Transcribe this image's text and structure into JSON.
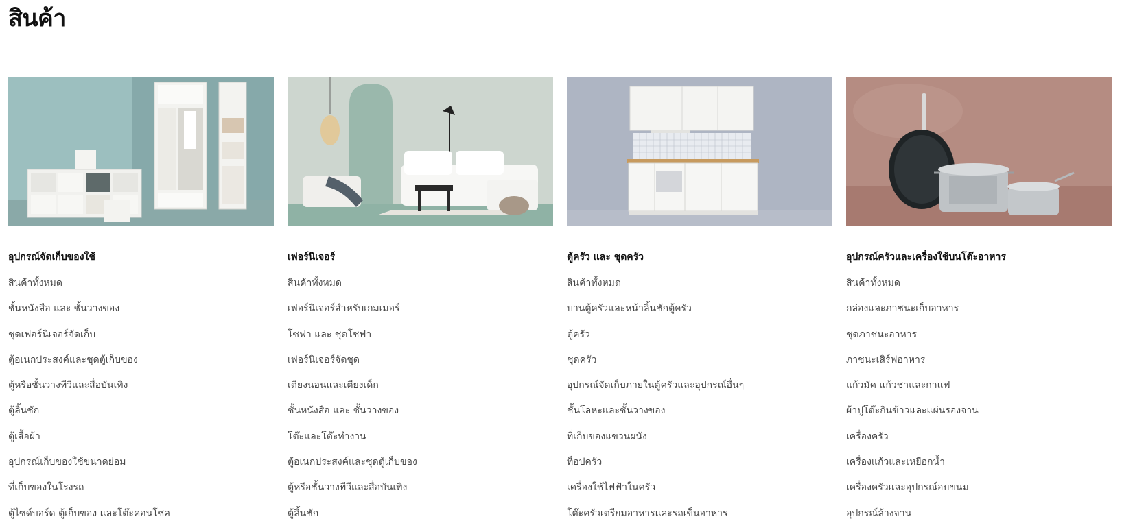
{
  "page": {
    "title": "สินค้า"
  },
  "categories": [
    {
      "title": "อุปกรณ์จัดเก็บของใช้",
      "image_icon": "storage-room-image",
      "links": [
        "สินค้าทั้งหมด",
        "ชั้นหนังสือ และ ชั้นวางของ",
        "ชุดเฟอร์นิเจอร์จัดเก็บ",
        "ตู้อเนกประสงค์และชุดตู้เก็บของ",
        "ตู้หรือชั้นวางทีวีและสื่อบันเทิง",
        "ตู้ลิ้นชัก",
        "ตู้เสื้อผ้า",
        "อุปกรณ์เก็บของใช้ขนาดย่อม",
        "ที่เก็บของในโรงรถ",
        "ตู้ไซด์บอร์ด ตู้เก็บของ และโต๊ะคอนโซล"
      ]
    },
    {
      "title": "เฟอร์นิเจอร์",
      "image_icon": "living-room-sofa-image",
      "links": [
        "สินค้าทั้งหมด",
        "เฟอร์นิเจอร์สำหรับเกมเมอร์",
        "โซฟา และ ชุดโซฟา",
        "เฟอร์นิเจอร์จัดชุด",
        "เตียงนอนและเตียงเด็ก",
        "ชั้นหนังสือ และ ชั้นวางของ",
        "โต๊ะและโต๊ะทำงาน",
        "ตู้อเนกประสงค์และชุดตู้เก็บของ",
        "ตู้หรือชั้นวางทีวีและสื่อบันเทิง",
        "ตู้ลิ้นชัก"
      ]
    },
    {
      "title": "ตู้ครัว และ ชุดครัว",
      "image_icon": "kitchen-cabinets-image",
      "links": [
        "สินค้าทั้งหมด",
        "บานตู้ครัวและหน้าลิ้นชักตู้ครัว",
        "ตู้ครัว",
        "ชุดครัว",
        "อุปกรณ์จัดเก็บภายในตู้ครัวและอุปกรณ์อื่นๆ",
        "ชั้นโลหะและชั้นวางของ",
        "ที่เก็บของแขวนผนัง",
        "ท็อปครัว",
        "เครื่องใช้ไฟฟ้าในครัว",
        "โต๊ะครัวเตรียมอาหารและรถเข็นอาหาร"
      ]
    },
    {
      "title": "อุปกรณ์ครัวและเครื่องใช้บนโต๊ะอาหาร",
      "image_icon": "cookware-pots-image",
      "links": [
        "สินค้าทั้งหมด",
        "กล่องและภาชนะเก็บอาหาร",
        "ชุดภาชนะอาหาร",
        "ภาชนะเสิร์ฟอาหาร",
        "แก้วมัค แก้วชาและกาแฟ",
        "ผ้าปูโต๊ะกินข้าวและแผ่นรองจาน",
        "เครื่องครัว",
        "เครื่องแก้วและเหยือกน้ำ",
        "เครื่องครัวและอุปกรณ์อบขนม",
        "อุปกรณ์ล้างจาน"
      ]
    }
  ]
}
